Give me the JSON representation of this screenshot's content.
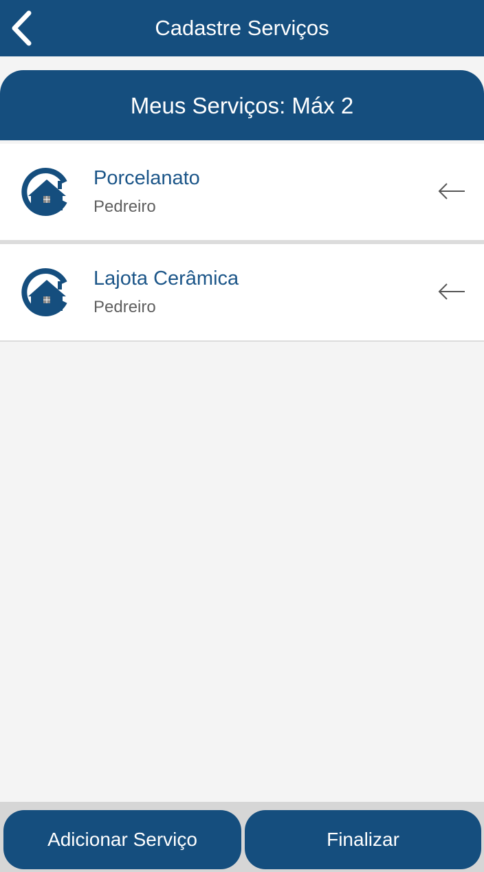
{
  "header": {
    "title": "Cadastre Serviços",
    "back_icon": "chevron-left-icon"
  },
  "section": {
    "title": "Meus Serviços: Máx 2"
  },
  "services": [
    {
      "title": "Porcelanato",
      "subtitle": "Pedreiro",
      "icon": "house-logo-icon",
      "action_icon": "arrow-left-icon"
    },
    {
      "title": "Lajota Cerâmica",
      "subtitle": "Pedreiro",
      "icon": "house-logo-icon",
      "action_icon": "arrow-left-icon"
    }
  ],
  "footer": {
    "add_label": "Adicionar Serviço",
    "finish_label": "Finalizar"
  },
  "colors": {
    "primary": "#154e7e",
    "background": "#f4f4f4",
    "title_text": "#1b5588",
    "subtitle_text": "#5f5f5f"
  }
}
